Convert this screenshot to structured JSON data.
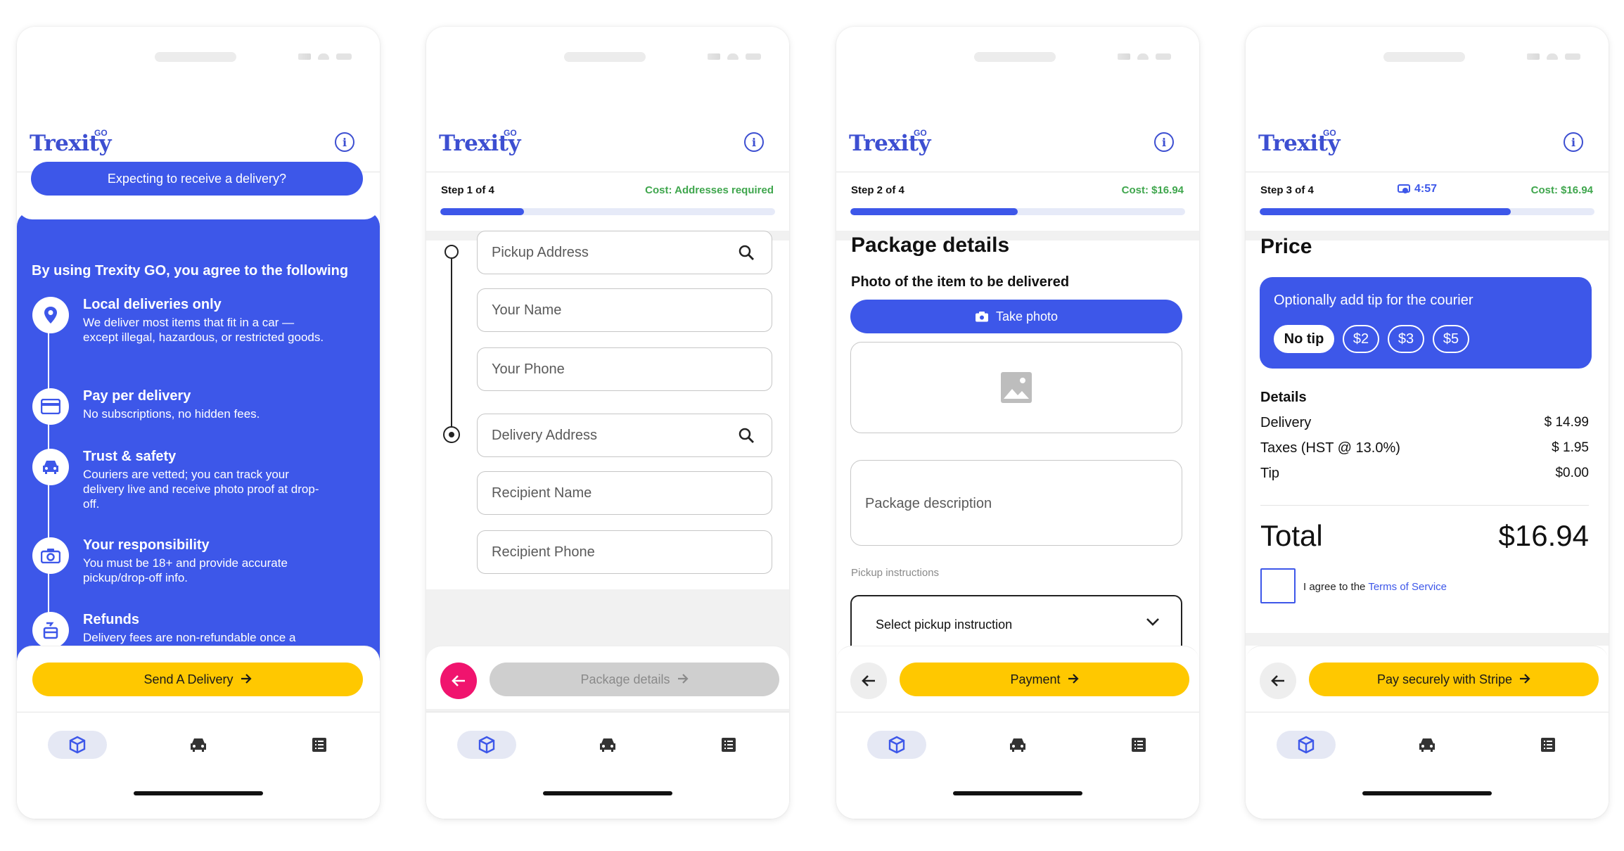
{
  "common": {
    "logo": "Trexity",
    "logo_sup": "GO",
    "info_icon": "i"
  },
  "screen1": {
    "expect_button": "Expecting to receive a delivery?",
    "agree_title": "By using Trexity GO, you agree to the following",
    "features": [
      {
        "icon": "location-pin-icon",
        "title": "Local deliveries only",
        "desc": "We deliver most items that fit in a car — except illegal, hazardous, or restricted goods."
      },
      {
        "icon": "credit-card-icon",
        "title": "Pay per delivery",
        "desc": "No subscriptions, no hidden fees."
      },
      {
        "icon": "car-icon",
        "title": "Trust & safety",
        "desc": "Couriers are vetted; you can track your delivery live and receive photo proof at drop-off."
      },
      {
        "icon": "camera-icon",
        "title": "Your responsibility",
        "desc": "You must be 18+ and provide accurate pickup/drop-off info."
      },
      {
        "icon": "refund-icon",
        "title": "Refunds",
        "desc": "Delivery fees are non-refundable once a courier is assigned (unless required by law)."
      }
    ],
    "send_button": "Send A Delivery"
  },
  "screen2": {
    "step": "Step 1 of 4",
    "cost": "Cost: Addresses required",
    "progress": 0.25,
    "fields": {
      "pickup_address": "Pickup Address",
      "your_name": "Your Name",
      "your_phone": "Your Phone",
      "delivery_address": "Delivery Address",
      "recipient_name": "Recipient Name",
      "recipient_phone": "Recipient Phone"
    },
    "next_button": "Package details"
  },
  "screen3": {
    "step": "Step 2 of 4",
    "cost": "Cost: $16.94",
    "progress": 0.5,
    "title": "Package details",
    "photo_label": "Photo of the item to be delivered",
    "take_photo": "Take photo",
    "description_placeholder": "Package description",
    "pickup_label": "Pickup instructions",
    "select_placeholder": "Select pickup instruction",
    "next_button": "Payment"
  },
  "screen4": {
    "step": "Step 3 of 4",
    "timer": "4:57",
    "cost": "Cost: $16.94",
    "progress": 0.75,
    "title": "Price",
    "tip_title": "Optionally add tip for the courier",
    "tip_options": [
      "No tip",
      "$2",
      "$3",
      "$5"
    ],
    "details_title": "Details",
    "rows": [
      {
        "label": "Delivery",
        "value": "$ 14.99"
      },
      {
        "label": "Taxes (HST @ 13.0%)",
        "value": "$ 1.95"
      },
      {
        "label": "Tip",
        "value": "$0.00"
      }
    ],
    "total_label": "Total",
    "total_value": "$16.94",
    "agree_text": "I agree to the",
    "terms_link": "Terms of Service",
    "pay_button": "Pay securely with Stripe"
  },
  "colors": {
    "brand_blue": "#3d57e9",
    "yellow": "#ffc800",
    "pink": "#f0146e",
    "green_cost": "#3fa64d"
  }
}
